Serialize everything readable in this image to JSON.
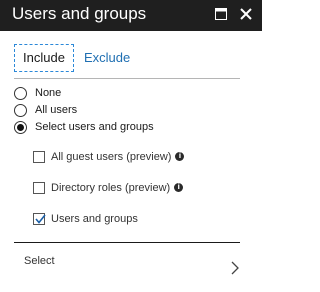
{
  "window": {
    "title": "Users and groups",
    "icons": [
      "maximize-icon",
      "close-icon"
    ]
  },
  "tabs": [
    {
      "label": "Include",
      "active": true
    },
    {
      "label": "Exclude",
      "active": false
    }
  ],
  "radio_options": [
    {
      "label": "None",
      "selected": false
    },
    {
      "label": "All users",
      "selected": false
    },
    {
      "label": "Select users and groups",
      "selected": true
    }
  ],
  "checkbox_options": [
    {
      "label": "All guest users (preview)",
      "checked": false,
      "info_icon": true
    },
    {
      "label": "Directory roles (preview)",
      "checked": false,
      "info_icon": true
    },
    {
      "label": "Users and groups",
      "checked": true,
      "info_icon": false
    }
  ],
  "select": {
    "label": "Select",
    "icon": "chevron-right-icon"
  },
  "colors": {
    "titlebar": "#1f1f1f",
    "accent": "#2b88d8",
    "link": "#1f6fb2"
  }
}
